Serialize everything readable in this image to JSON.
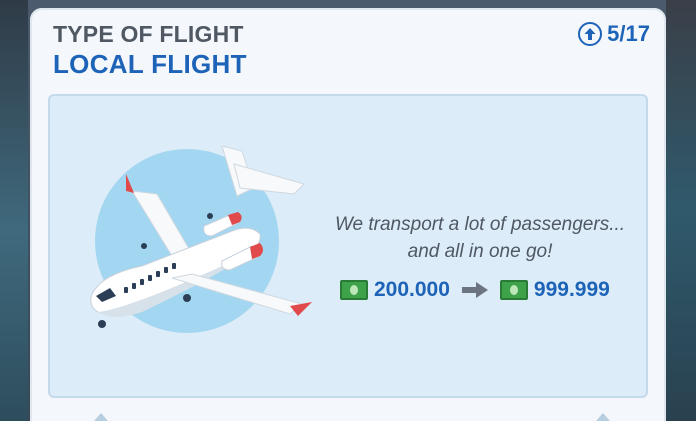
{
  "card": {
    "type_label": "TYPE OF FLIGHT",
    "flight_name": "LOCAL FLIGHT",
    "level": "5/17"
  },
  "panel": {
    "description_line1": "We transport a lot of passengers...",
    "description_line2": "and all in one go!",
    "price_from": "200.000",
    "price_to": "999.999"
  },
  "icons": {
    "level": "up-arrow-circle-icon",
    "currency": "cash-icon",
    "transition": "right-arrow-icon",
    "illustration": "airplane-illustration"
  },
  "colors": {
    "title_blue": "#1d63b8",
    "label_gray": "#4f5863",
    "panel_bg": "#dcecf8",
    "circle": "#9fd3ef",
    "cash_green": "#3da24a",
    "accent_red": "#e14a4a"
  }
}
